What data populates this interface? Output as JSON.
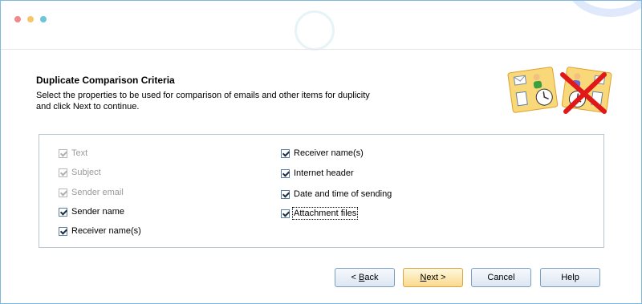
{
  "header": {
    "title": "Duplicate Comparison Criteria",
    "subtitle": "Select the properties to be used for comparison of emails and other items for duplicity and click Next to continue."
  },
  "criteria": {
    "left": [
      {
        "label": "Text",
        "checked": true,
        "enabled": false
      },
      {
        "label": "Subject",
        "checked": true,
        "enabled": false
      },
      {
        "label": "Sender email",
        "checked": true,
        "enabled": false
      },
      {
        "label": "Sender name",
        "checked": true,
        "enabled": true
      },
      {
        "label": "Receiver name(s)",
        "checked": true,
        "enabled": true
      }
    ],
    "right": [
      {
        "label": "Receiver name(s)",
        "checked": true,
        "enabled": true
      },
      {
        "label": "Internet header",
        "checked": true,
        "enabled": true
      },
      {
        "label": "Date and time of sending",
        "checked": true,
        "enabled": true
      },
      {
        "label": "Attachment files",
        "checked": true,
        "enabled": true
      }
    ]
  },
  "buttons": {
    "back_prefix": "< ",
    "back_key": "B",
    "back_rest": "ack",
    "next_key": "N",
    "next_rest": "ext >",
    "cancel": "Cancel",
    "help": "Help"
  },
  "colors": {
    "frame_border": "#7cb8e0",
    "primary_button": "#f9d98c"
  },
  "icons": {
    "logo": "duplicate-comparison-icon"
  }
}
